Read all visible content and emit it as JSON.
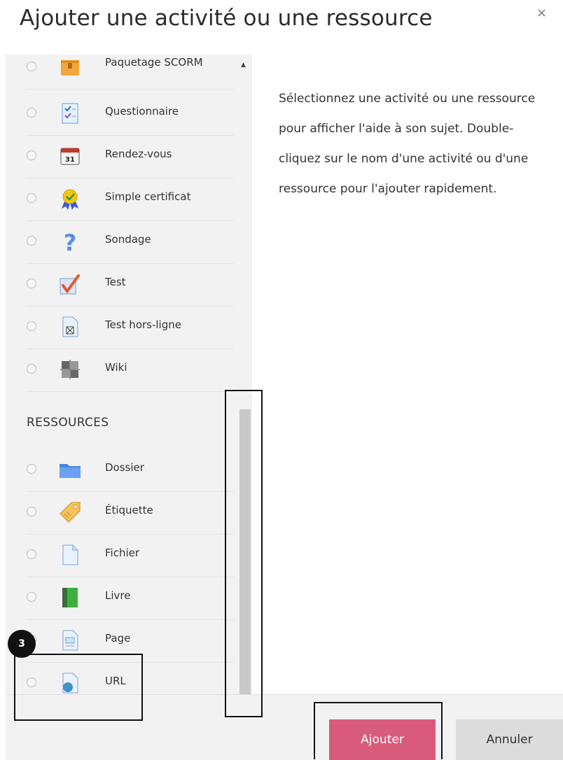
{
  "dialog": {
    "title": "Ajouter une activité ou une ressource",
    "close_label": "×"
  },
  "activities": [
    {
      "label": "Paquetage SCORM",
      "icon": "scorm-package-icon"
    },
    {
      "label": "Questionnaire",
      "icon": "questionnaire-icon"
    },
    {
      "label": "Rendez-vous",
      "icon": "calendar-icon"
    },
    {
      "label": "Simple certificat",
      "icon": "certificate-icon"
    },
    {
      "label": "Sondage",
      "icon": "question-mark-icon"
    },
    {
      "label": "Test",
      "icon": "checkmark-icon"
    },
    {
      "label": "Test hors-ligne",
      "icon": "offline-test-icon"
    },
    {
      "label": "Wiki",
      "icon": "wiki-icon"
    }
  ],
  "resources_heading": "RESSOURCES",
  "resources": [
    {
      "label": "Dossier",
      "icon": "folder-icon"
    },
    {
      "label": "Étiquette",
      "icon": "label-tag-icon"
    },
    {
      "label": "Fichier",
      "icon": "file-icon"
    },
    {
      "label": "Livre",
      "icon": "book-icon"
    },
    {
      "label": "Page",
      "icon": "page-icon"
    },
    {
      "label": "URL",
      "icon": "url-globe-icon"
    }
  ],
  "help_text": "Sélectionnez une activité ou une ressource pour afficher l'aide à son sujet. Double-cliquez sur le nom d'une activité ou d'une ressource pour l'ajouter rapidement.",
  "annotation_badge": "3",
  "buttons": {
    "add": "Ajouter",
    "cancel": "Annuler"
  },
  "colors": {
    "primary_button": "#d95b7c",
    "panel_bg": "#f2f2f2"
  }
}
